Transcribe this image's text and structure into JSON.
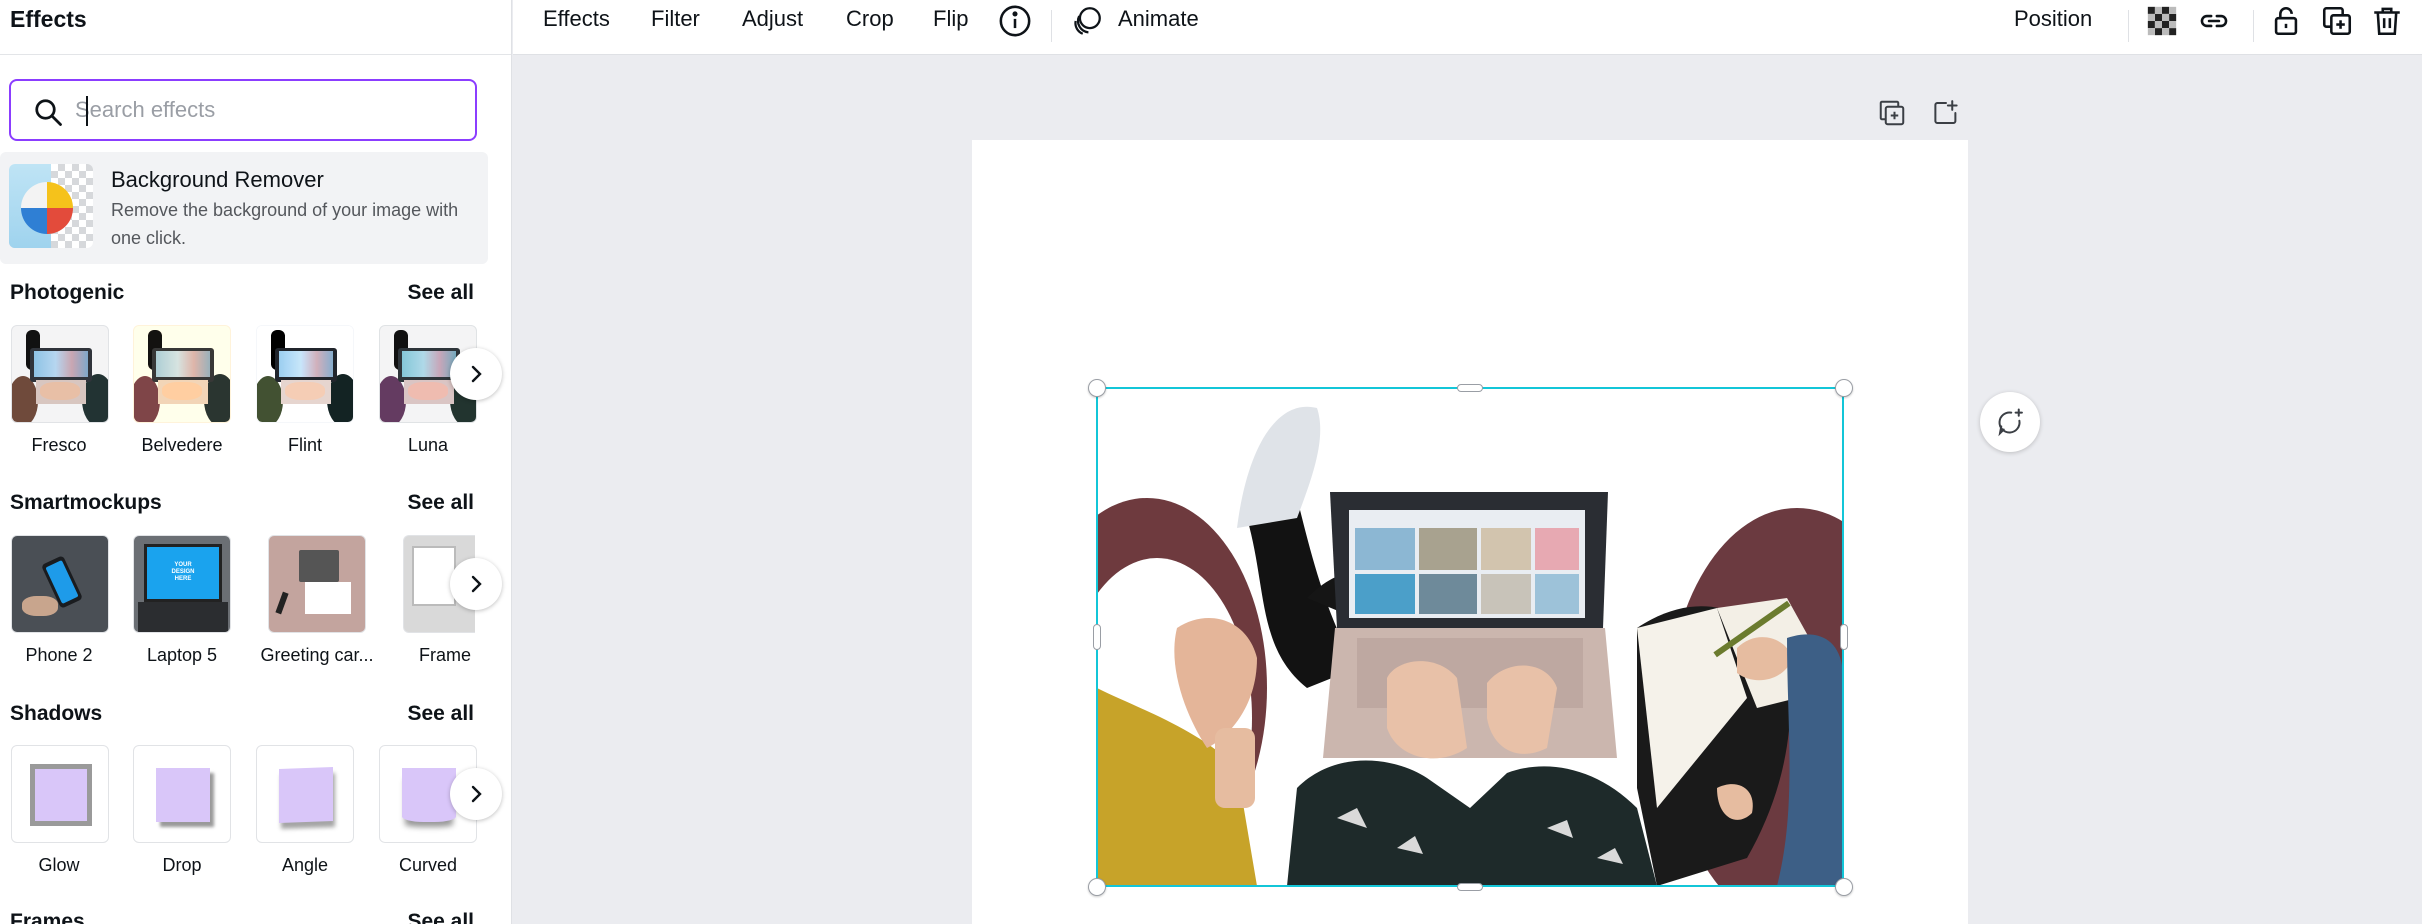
{
  "panel": {
    "title": "Effects",
    "search": {
      "placeholder": "Search effects",
      "value": ""
    },
    "background_remover": {
      "name": "Background Remover",
      "description": "Remove the background of your image with one click."
    },
    "sections": [
      {
        "title": "Photogenic",
        "see_all": "See all",
        "items": [
          "Fresco",
          "Belvedere",
          "Flint",
          "Luna"
        ]
      },
      {
        "title": "Smartmockups",
        "see_all": "See all",
        "items": [
          "Phone 2",
          "Laptop 5",
          "Greeting car...",
          "Frame"
        ]
      },
      {
        "title": "Shadows",
        "see_all": "See all",
        "items": [
          "Glow",
          "Drop",
          "Angle",
          "Curved"
        ]
      },
      {
        "title": "Frames",
        "see_all": "See all"
      }
    ]
  },
  "toolbar": {
    "effects": "Effects",
    "filter": "Filter",
    "adjust": "Adjust",
    "crop": "Crop",
    "flip": "Flip",
    "animate": "Animate",
    "position": "Position"
  },
  "mockup_text": "YOUR DESIGN HERE",
  "colors": {
    "accent_purple": "#8b3dff",
    "selection_cyan": "#13c6d8",
    "canvas_bg": "#ebecf0",
    "shadow_tile": "#d9c6f9"
  },
  "icons": [
    "search-icon",
    "chevron-right-icon",
    "info-icon",
    "animate-icon",
    "transparency-icon",
    "link-icon",
    "lock-icon",
    "duplicate-icon",
    "trash-icon",
    "add-page-icon",
    "share-page-icon",
    "add-comment-icon"
  ]
}
